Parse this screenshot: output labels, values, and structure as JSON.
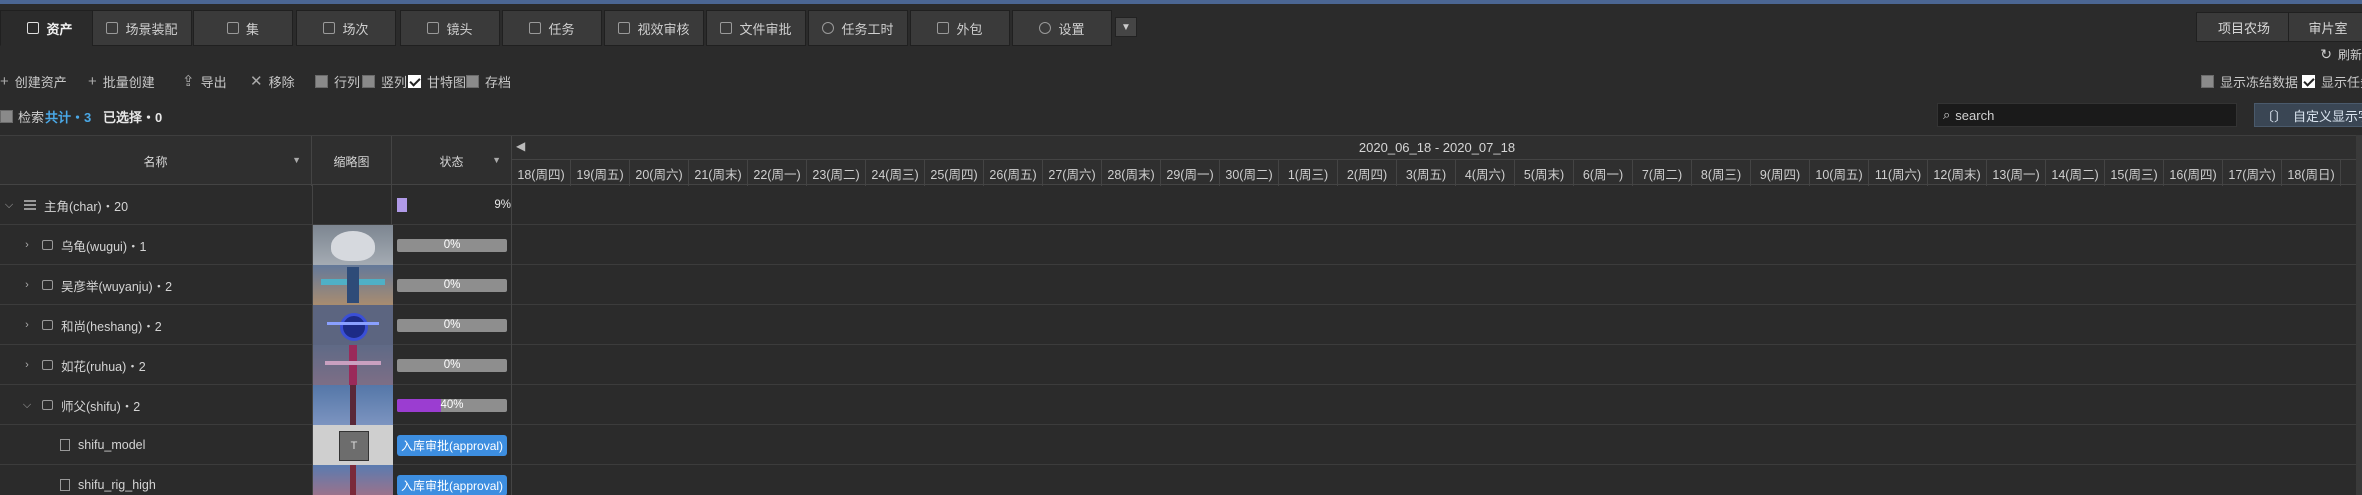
{
  "tabs": [
    {
      "label": "资产",
      "icon": "box-icon",
      "active": true
    },
    {
      "label": "场景装配",
      "icon": "scene-icon"
    },
    {
      "label": "集",
      "icon": "episode-icon"
    },
    {
      "label": "场次",
      "icon": "sequence-icon"
    },
    {
      "label": "镜头",
      "icon": "shot-icon"
    },
    {
      "label": "任务",
      "icon": "task-icon"
    },
    {
      "label": "视效审核",
      "icon": "vfx-review-icon"
    },
    {
      "label": "文件审批",
      "icon": "file-approval-icon"
    },
    {
      "label": "任务工时",
      "icon": "clock-icon"
    },
    {
      "label": "外包",
      "icon": "outsource-icon"
    },
    {
      "label": "设置",
      "icon": "gear-icon"
    }
  ],
  "right_buttons": {
    "project_farm": "项目农场",
    "screening_room": "审片室"
  },
  "toolbar": {
    "create_asset": "创建资产",
    "batch_create": "批量创建",
    "export": "导出",
    "remove": "移除",
    "row_view": "行列",
    "column_view": "竖列",
    "gantt": "甘特图",
    "archive": "存档",
    "refresh": "刷新",
    "show_frozen": "显示冻结数据",
    "show_tasks": "显示任务"
  },
  "summary": {
    "search_label": "检索",
    "total": "共计・3",
    "selected": "已选择・0",
    "search_placeholder": "search",
    "customize_fields": "自定义显示字段"
  },
  "columns": {
    "name": "名称",
    "thumbnail": "缩略图",
    "status": "状态"
  },
  "gantt": {
    "range": "2020_06_18 - 2020_07_18",
    "days": [
      "18(周四)",
      "19(周五)",
      "20(周六)",
      "21(周末)",
      "22(周一)",
      "23(周二)",
      "24(周三)",
      "25(周四)",
      "26(周五)",
      "27(周六)",
      "28(周末)",
      "29(周一)",
      "30(周二)",
      "1(周三)",
      "2(周四)",
      "3(周五)",
      "4(周六)",
      "5(周末)",
      "6(周一)",
      "7(周二)",
      "8(周三)",
      "9(周四)",
      "10(周五)",
      "11(周六)",
      "12(周末)",
      "13(周一)",
      "14(周二)",
      "15(周三)",
      "16(周四)",
      "17(周六)",
      "18(周日)"
    ]
  },
  "rows": [
    {
      "label": "主角(char)・20",
      "type": "group",
      "progress": 0.09,
      "status_text": "9%"
    },
    {
      "label": "乌龟(wugui)・1",
      "type": "asset",
      "progress": 0,
      "status_text": "0%",
      "thumb": "wugui"
    },
    {
      "label": "吴彦举(wuyanju)・2",
      "type": "asset",
      "progress": 0,
      "status_text": "0%",
      "thumb": "wuyanju"
    },
    {
      "label": "和尚(heshang)・2",
      "type": "asset",
      "progress": 0,
      "status_text": "0%",
      "thumb": "heshang"
    },
    {
      "label": "如花(ruhua)・2",
      "type": "asset",
      "progress": 0,
      "status_text": "0%",
      "thumb": "ruhua"
    },
    {
      "label": "师父(shifu)・2",
      "type": "asset-open",
      "progress": 0.4,
      "status_text": "40%",
      "thumb": "shifu"
    },
    {
      "label": "shifu_model",
      "type": "task",
      "status_text": "入库审批(approval)",
      "thumb": "model"
    },
    {
      "label": "shifu_rig_high",
      "type": "task",
      "status_text": "入库审批(approval)",
      "thumb": "rig"
    }
  ]
}
